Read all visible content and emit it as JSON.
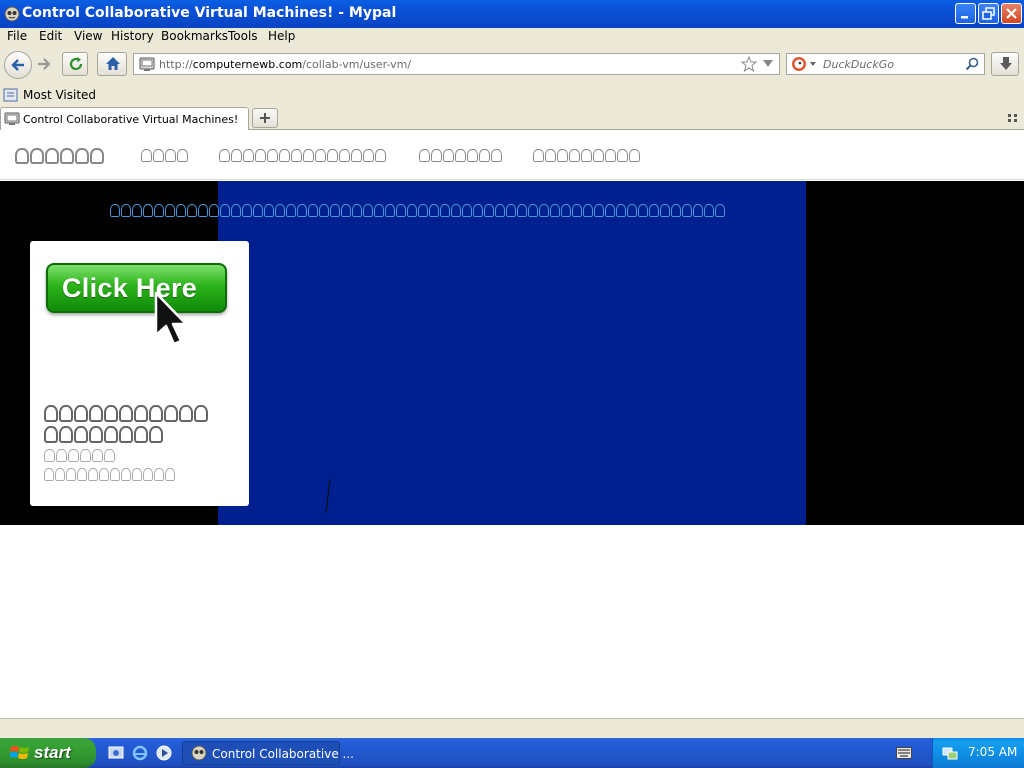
{
  "window": {
    "title": "Control Collaborative Virtual Machines! - Mypal"
  },
  "menubar": {
    "items": [
      "File",
      "Edit",
      "View",
      "History",
      "Bookmarks",
      "Tools",
      "Help"
    ]
  },
  "navbar": {
    "url_prefix": "http://",
    "url_domain": "computernewb.com",
    "url_path": "/collab-vm/user-vm/",
    "search_placeholder": "DuckDuckGo"
  },
  "bookmarks": {
    "items": [
      "Most Visited"
    ]
  },
  "tabs": [
    {
      "label": "Control Collaborative Virtual Machines!"
    }
  ],
  "page": {
    "card_button_label": "Click Here"
  },
  "taskbar": {
    "start_label": "start",
    "task_label": "Control Collaborative ...",
    "clock": "7:05 AM"
  },
  "colors": {
    "titlebar": "#0a4fd6",
    "vm_screen": "#00208f",
    "banner_text": "#4a96d6",
    "taskbar": "#245edb",
    "start_button": "#37a335"
  }
}
